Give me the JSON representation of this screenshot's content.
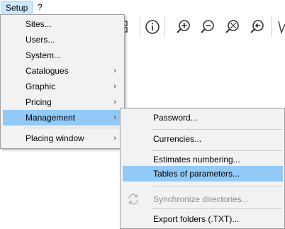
{
  "menubar": {
    "setup": "Setup",
    "help": "?"
  },
  "setup_menu": {
    "items": [
      {
        "label": "Sites..."
      },
      {
        "label": "Users..."
      },
      {
        "label": "System..."
      },
      {
        "label": "Catalogues"
      },
      {
        "label": "Graphic"
      },
      {
        "label": "Pricing"
      },
      {
        "label": "Management"
      },
      {
        "label": "Placing window"
      }
    ],
    "submenu_arrow": "›"
  },
  "management_menu": {
    "items": [
      {
        "label": "Password..."
      },
      {
        "label": "Currencies..."
      },
      {
        "label": "Estimates numbering..."
      },
      {
        "label": "Tables of parameters..."
      },
      {
        "label": "Synchronize directories..."
      },
      {
        "label": "Export folders (.TXT)..."
      }
    ]
  },
  "colors": {
    "highlight": "#91c9f7",
    "menu_bg": "#f2f2f2",
    "accent": "#e07b1a"
  },
  "toolbar_icons": [
    "grid-icon",
    "info-icon",
    "zoom-in-icon",
    "zoom-out-icon",
    "zoom-fit-icon",
    "zoom-previous-icon",
    "tool-icon"
  ]
}
